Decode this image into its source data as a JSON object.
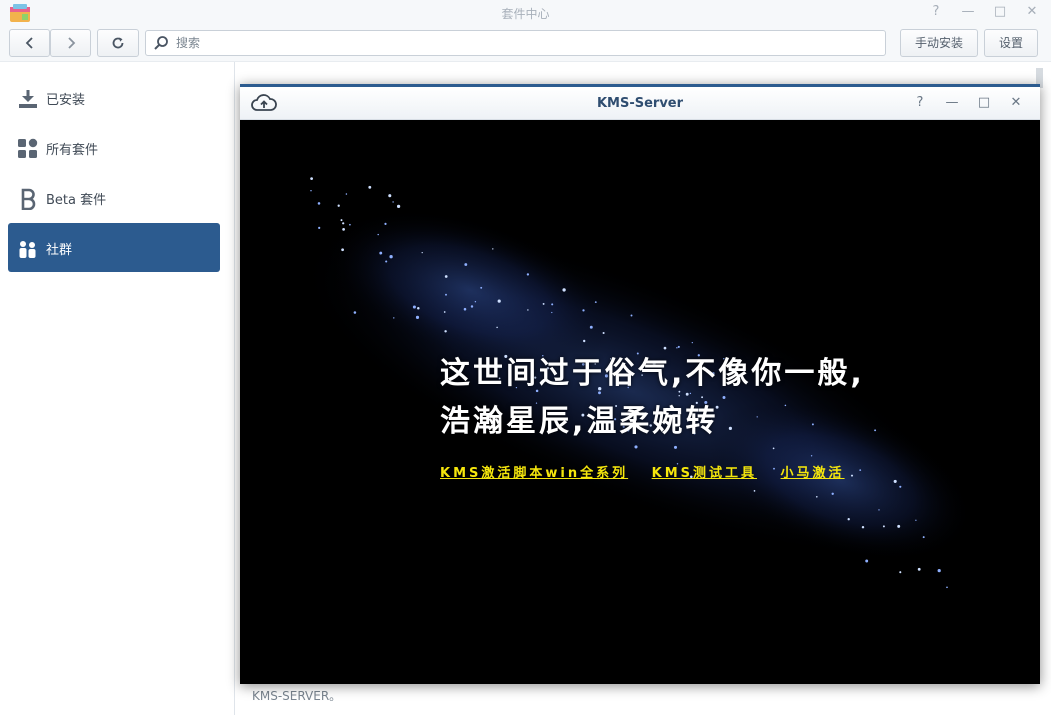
{
  "window": {
    "title": "套件中心",
    "controls": {
      "help": "?",
      "minimize": "—",
      "maximize": "□",
      "close": "✕"
    }
  },
  "toolbar": {
    "search_placeholder": "搜索",
    "manual_install_label": "手动安装",
    "settings_label": "设置"
  },
  "sidebar": {
    "items": [
      {
        "label": "已安装",
        "icon": "download-icon",
        "active": false
      },
      {
        "label": "所有套件",
        "icon": "grid-icon",
        "active": false
      },
      {
        "label": "Beta 套件",
        "icon": "beta-icon",
        "active": false
      },
      {
        "label": "社群",
        "icon": "community-icon",
        "active": true
      }
    ]
  },
  "content": {
    "footer_text": "KMS-SERVER。"
  },
  "popup": {
    "title": "KMS-Server",
    "poem_line1": "这世间过于俗气,不像你一般,",
    "poem_line2": "浩瀚星辰,温柔婉转",
    "links": [
      "KMS激活脚本win全系列",
      "KMS测试工具",
      "小马激活"
    ]
  },
  "colors": {
    "accent": "#2c5b8f",
    "link_yellow": "#f5e60c",
    "stage_background": "#000000"
  }
}
